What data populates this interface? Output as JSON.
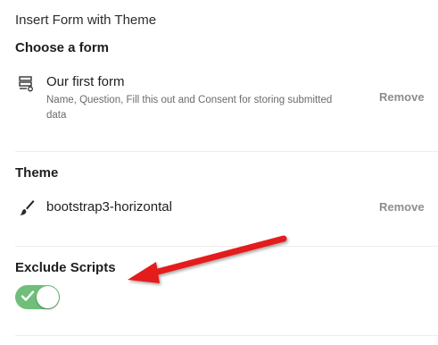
{
  "panel": {
    "title": "Insert Form with Theme"
  },
  "form_section": {
    "heading": "Choose a form",
    "item": {
      "icon": "form-icon",
      "title": "Our first form",
      "description": "Name, Question, Fill this out and Consent for storing submitted data",
      "remove_label": "Remove"
    }
  },
  "theme_section": {
    "heading": "Theme",
    "item": {
      "icon": "paintbrush-icon",
      "title": "bootstrap3-horizontal",
      "remove_label": "Remove"
    }
  },
  "scripts_section": {
    "heading": "Exclude Scripts",
    "toggle": {
      "checked": true,
      "color_on": "#6fbf7a"
    }
  },
  "annotation": {
    "icon": "arrow-icon",
    "color": "#e41f1f"
  }
}
